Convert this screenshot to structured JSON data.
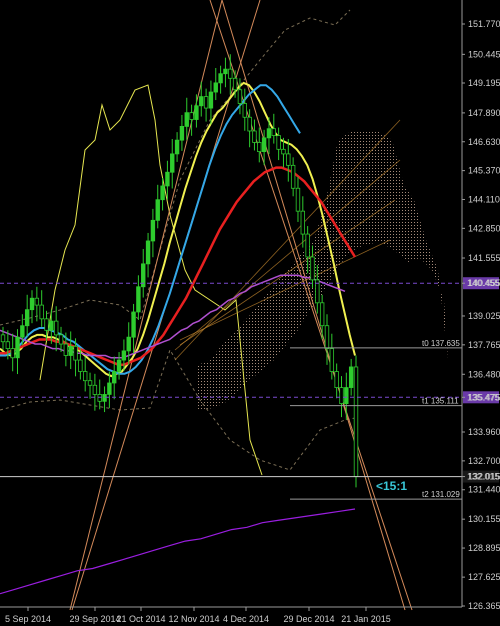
{
  "chart_data": {
    "type": "candlestick",
    "instrument_hint": "",
    "y_axis_ticks": [
      "151.770",
      "150.445",
      "149.195",
      "147.890",
      "146.630",
      "145.370",
      "144.110",
      "142.850",
      "141.555",
      "140.455",
      "139.025",
      "137.765",
      "136.480",
      "135.475",
      "133.960",
      "132.700",
      "132.015",
      "131.440",
      "130.155",
      "128.895",
      "127.625",
      "126.365"
    ],
    "x_axis_ticks": [
      "5 Sep 2014",
      "29 Sep 2014",
      "21 Oct 2014",
      "12 Nov 2014",
      "4 Dec 2014",
      "29 Dec 2014",
      "21 Jan 2015"
    ],
    "ylim": [
      126.365,
      151.77
    ],
    "price_badges": [
      {
        "label": "140.455",
        "value": 140.455,
        "color": "#6a3aa8"
      },
      {
        "label": "135.475",
        "value": 135.475,
        "color": "#6a3aa8"
      },
      {
        "label": "132.015",
        "value": 132.015,
        "color": "#1a1a1a"
      }
    ],
    "levels": [
      {
        "label": "t0 137.635",
        "value": 137.635
      },
      {
        "label": "t1 135.111",
        "value": 135.111
      },
      {
        "label": "t2 131.029",
        "value": 131.029
      }
    ],
    "annotation": "<15:1",
    "closes": [
      137.9,
      137.6,
      137.2,
      138.1,
      138.6,
      139.3,
      139.8,
      139.5,
      138.9,
      138.4,
      138.8,
      138.2,
      137.8,
      137.3,
      137.7,
      137.1,
      136.6,
      136.2,
      136.0,
      135.6,
      135.3,
      135.6,
      136.1,
      136.6,
      137.1,
      137.5,
      138.1,
      139.2,
      140.3,
      141.3,
      142.3,
      143.2,
      144.1,
      144.7,
      145.3,
      146.1,
      146.7,
      147.3,
      147.9,
      147.6,
      148.2,
      148.6,
      148.1,
      148.8,
      149.2,
      149.6,
      149.8,
      149.4,
      148.9,
      148.3,
      147.7,
      147.1,
      146.6,
      146.2,
      146.8,
      147.2,
      146.9,
      146.3,
      146.1,
      145.6,
      144.6,
      143.6,
      142.6,
      141.6,
      140.6,
      139.6,
      138.6,
      137.6,
      136.6,
      135.9,
      135.2,
      135.9,
      136.8,
      132.015
    ],
    "series": [
      {
        "name": "",
        "color": "#f0f050",
        "values": [
          137.6,
          137.4,
          137.3,
          137.4,
          137.6,
          137.9,
          138.1,
          138.2,
          138.2,
          138.1,
          138.1,
          138.0,
          137.9,
          137.7,
          137.6,
          137.5,
          137.3,
          137.1,
          136.9,
          136.7,
          136.5,
          136.4,
          136.5,
          136.6,
          136.9,
          137.2,
          137.6,
          138.2,
          138.9,
          139.7,
          140.5,
          141.3,
          142.2,
          143.0,
          143.8,
          144.6,
          145.3,
          146.0,
          146.6,
          147.1,
          147.5,
          147.9,
          148.1,
          148.4,
          148.7,
          149.0,
          149.2,
          149.1,
          148.8,
          148.4,
          147.9,
          147.4,
          147.0,
          146.7,
          146.6,
          146.5,
          146.3,
          146.0,
          145.6,
          145.0,
          144.2,
          143.3,
          142.3,
          141.3,
          140.2,
          139.2,
          138.2,
          137.3
        ]
      },
      {
        "name": "",
        "color": "#34a8e8",
        "values": [
          137.3,
          137.3,
          137.4,
          137.6,
          137.9,
          138.2,
          138.4,
          138.5,
          138.5,
          138.4,
          138.3,
          138.2,
          138.0,
          137.9,
          137.7,
          137.5,
          137.3,
          137.1,
          136.9,
          136.7,
          136.6,
          136.5,
          136.5,
          136.6,
          136.8,
          137.1,
          137.5,
          138.0,
          138.6,
          139.3,
          140.0,
          140.8,
          141.6,
          142.4,
          143.2,
          144.0,
          144.8,
          145.6,
          146.3,
          146.9,
          147.4,
          147.8,
          148.1,
          148.4,
          148.7,
          148.9,
          149.1,
          149.1,
          148.9,
          148.6,
          148.2,
          147.8,
          147.4,
          147.0
        ]
      },
      {
        "name": "",
        "color": "#e82020",
        "values": [
          137.4,
          137.4,
          137.5,
          137.6,
          137.7,
          137.8,
          137.9,
          138.0,
          138.0,
          138.0,
          137.9,
          137.9,
          137.8,
          137.7,
          137.6,
          137.5,
          137.4,
          137.3,
          137.2,
          137.1,
          137.0,
          136.9,
          136.9,
          137.0,
          137.1,
          137.2,
          137.4,
          137.6,
          137.9,
          138.2,
          138.6,
          139.0,
          139.4,
          139.8,
          140.3,
          140.8,
          141.3,
          141.8,
          142.3,
          142.8,
          143.2,
          143.6,
          144.0,
          144.3,
          144.6,
          144.9,
          145.1,
          145.3,
          145.4,
          145.5,
          145.5,
          145.4,
          145.3,
          145.1,
          144.9,
          144.6,
          144.3,
          144.0,
          143.6,
          143.2,
          142.8,
          142.4,
          142.0,
          141.6
        ]
      },
      {
        "name": "",
        "color": "#b050d0",
        "values": [
          138.4,
          138.3,
          138.2,
          138.1,
          138.0,
          137.9,
          137.8,
          137.8,
          137.7,
          137.6,
          137.6,
          137.5,
          137.5,
          137.4,
          137.4,
          137.3,
          137.3,
          137.3,
          137.3,
          137.2,
          137.2,
          137.2,
          137.3,
          137.4,
          137.5,
          137.6,
          137.7,
          137.8,
          137.9,
          138.0,
          138.2,
          138.4,
          138.5,
          138.7,
          138.8,
          139.0,
          139.2,
          139.3,
          139.5,
          139.7,
          139.8,
          140.0,
          140.1,
          140.3,
          140.4,
          140.5,
          140.6,
          140.7,
          140.8,
          140.8,
          140.8,
          140.8,
          140.7,
          140.7,
          140.6,
          140.5,
          140.4,
          140.3,
          140.2,
          140.1
        ]
      },
      {
        "name": "",
        "color": "#9a1ee0",
        "values": [
          126.9,
          127.1,
          127.3,
          127.5,
          127.7,
          127.9,
          128.0,
          128.2,
          128.4,
          128.6,
          128.8,
          129.0,
          129.2,
          129.3,
          129.5,
          129.7,
          129.8,
          130.0,
          130.1,
          130.2,
          130.3,
          130.4,
          130.5,
          130.6
        ]
      }
    ],
    "grid": false,
    "title": "",
    "xlabel": "",
    "ylabel": ""
  }
}
